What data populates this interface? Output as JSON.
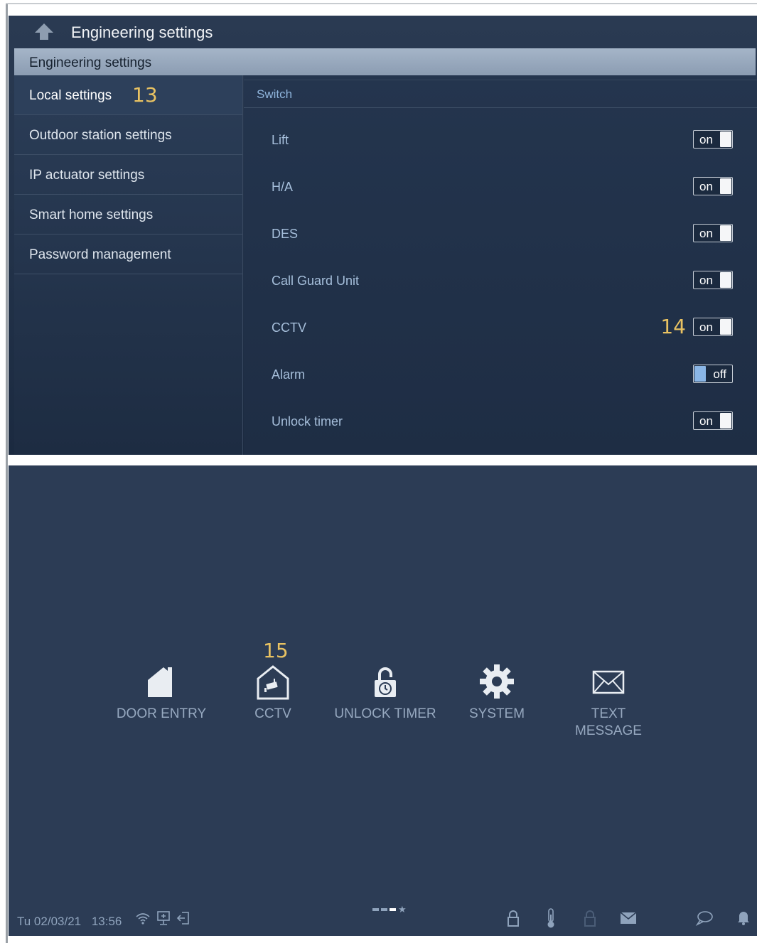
{
  "top": {
    "title": "Engineering settings",
    "section": "Engineering settings",
    "sidebar": [
      {
        "label": "Local settings",
        "active": true
      },
      {
        "label": "Outdoor station settings",
        "active": false
      },
      {
        "label": "IP actuator settings",
        "active": false
      },
      {
        "label": "Smart home settings",
        "active": false
      },
      {
        "label": "Password management",
        "active": false
      }
    ],
    "callout_13": "13",
    "switch_header": "Switch",
    "switches": [
      {
        "label": "Lift",
        "state": "on"
      },
      {
        "label": "H/A",
        "state": "on"
      },
      {
        "label": "DES",
        "state": "on"
      },
      {
        "label": "Call Guard Unit",
        "state": "on"
      },
      {
        "label": "CCTV",
        "state": "on"
      },
      {
        "label": "Alarm",
        "state": "off"
      },
      {
        "label": "Unlock timer",
        "state": "on"
      }
    ],
    "callout_14": "14"
  },
  "bottom": {
    "callout_15": "15",
    "tiles": [
      {
        "label": "DOOR ENTRY",
        "icon": "house-icon"
      },
      {
        "label": "CCTV",
        "icon": "camera-house-icon"
      },
      {
        "label": "UNLOCK TIMER",
        "icon": "lock-timer-icon"
      },
      {
        "label": "SYSTEM",
        "icon": "gear-icon"
      },
      {
        "label": "TEXT MESSAGE",
        "icon": "envelope-icon"
      }
    ],
    "status": {
      "date": "Tu 02/03/21",
      "time": "13:56",
      "icons": [
        "wifi-icon",
        "monitor-icon",
        "exit-icon",
        "lock-icon",
        "thermometer-icon",
        "lock-dim-icon",
        "mail-icon",
        "chat-icon",
        "bell-icon"
      ]
    },
    "pager": {
      "pages": 3,
      "active_index": 2
    }
  },
  "colors": {
    "panel_bg": "#2c3c55",
    "accent_callout": "#e8c262",
    "label_blue": "#a6bfdb",
    "knob_off": "#8ab6e6"
  }
}
